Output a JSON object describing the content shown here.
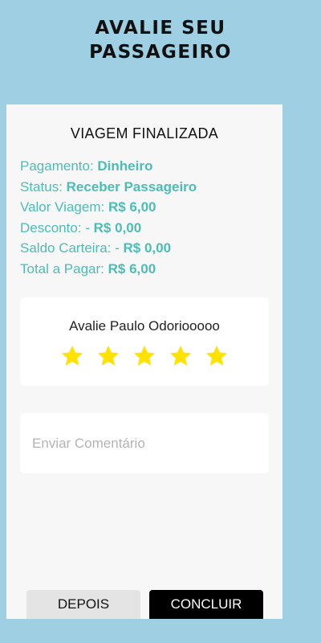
{
  "header": {
    "title_line1": "AVALIE SEU",
    "title_line2": "PASSAGEIRO"
  },
  "trip": {
    "title": "VIAGEM FINALIZADA",
    "rows": [
      {
        "label": "Pagamento: ",
        "value": "Dinheiro"
      },
      {
        "label": "Status: ",
        "value": "Receber Passageiro"
      },
      {
        "label": "Valor Viagem:  ",
        "value": "R$ 6,00"
      },
      {
        "label": "Desconto:  -  ",
        "value": "R$ 0,00"
      },
      {
        "label": "Saldo Carteira:  -  ",
        "value": "R$ 0,00"
      },
      {
        "label": "Total a Pagar:  ",
        "value": "R$ 6,00"
      }
    ]
  },
  "rating": {
    "label": "Avalie Paulo Odoriooooo",
    "stars_filled": 5,
    "stars_total": 5,
    "star_color": "#ffe200"
  },
  "comment": {
    "placeholder": "Enviar Comentário",
    "value": ""
  },
  "actions": {
    "later_label": "DEPOIS",
    "done_label": "CONCLUIR"
  },
  "colors": {
    "background": "#9ecfe3",
    "accent": "#4bbdb5",
    "card": "#f7f7f7"
  }
}
